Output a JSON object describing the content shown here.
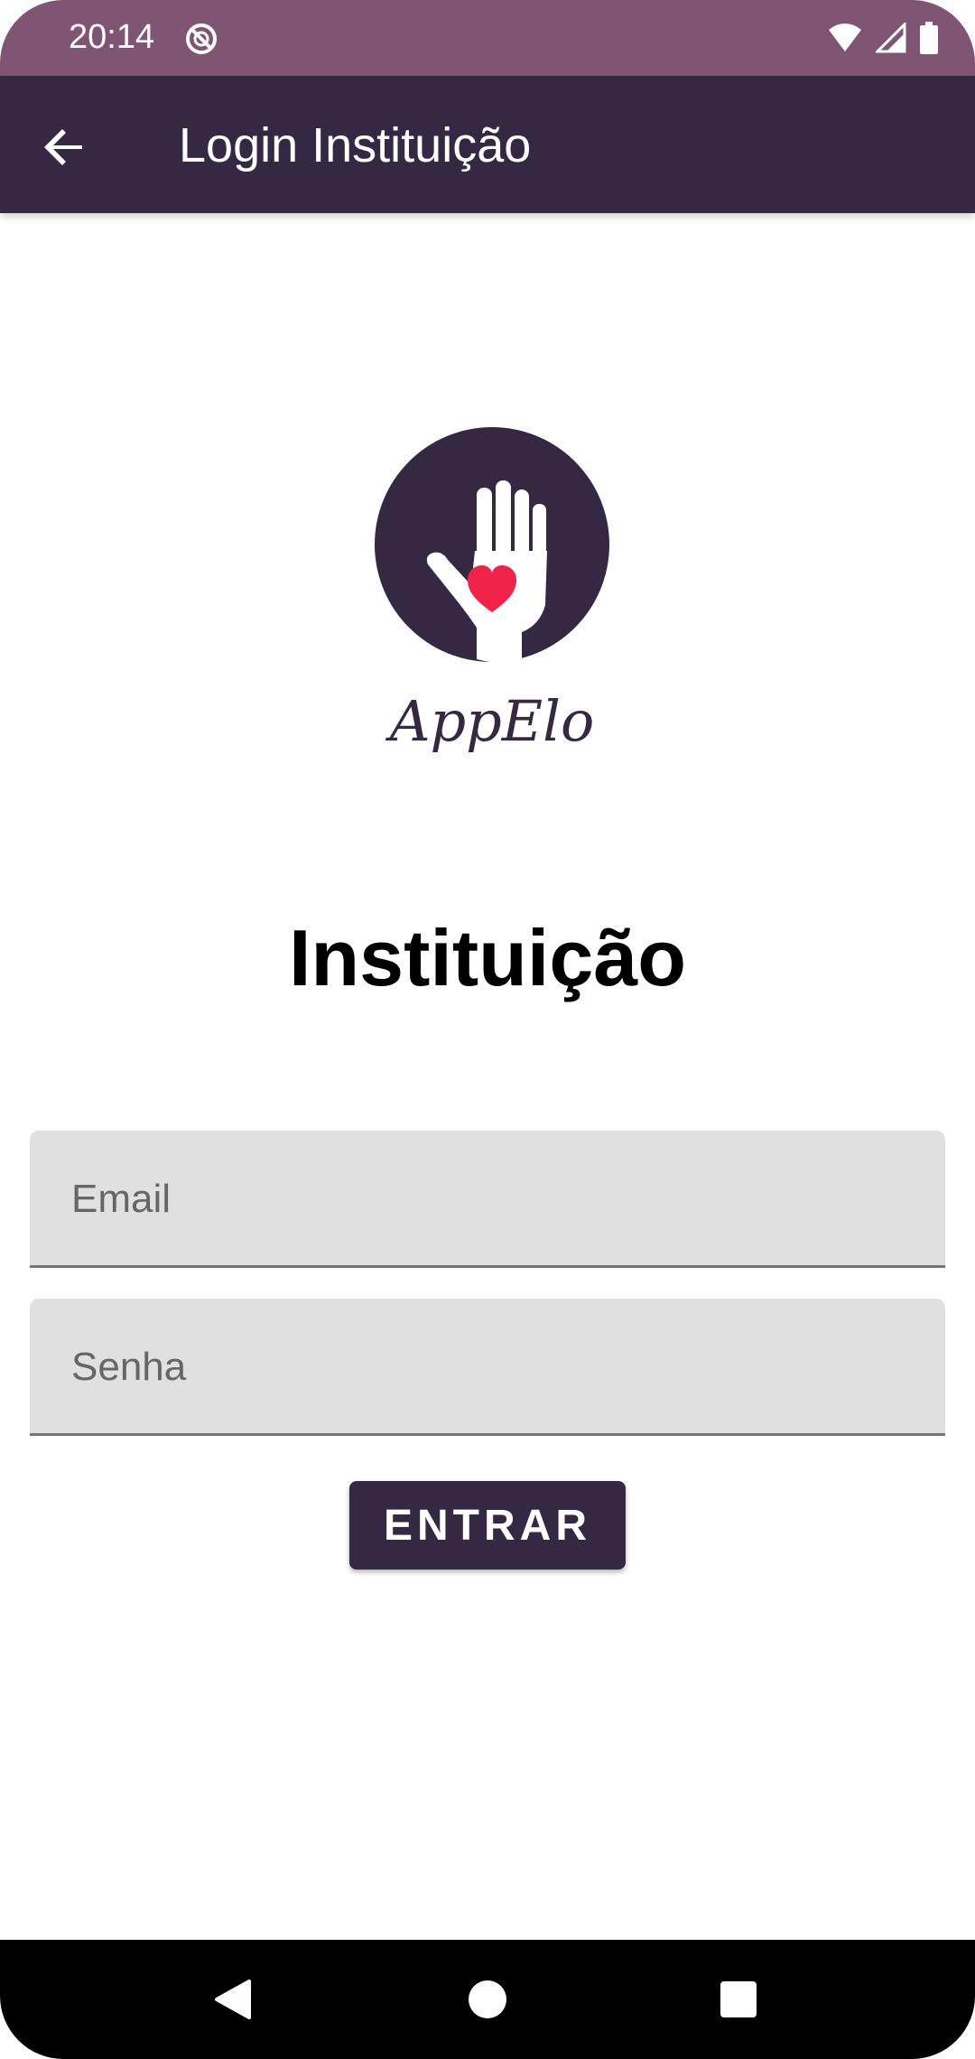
{
  "status_bar": {
    "time": "20:14",
    "icons": [
      "do-not-disturb-icon",
      "wifi-icon",
      "signal-icon",
      "battery-icon"
    ]
  },
  "app_bar": {
    "title": "Login Instituição",
    "back_icon": "arrow-back-icon"
  },
  "logo": {
    "text": "AppElo",
    "icon": "hand-heart-icon"
  },
  "heading": "Instituição",
  "form": {
    "email": {
      "placeholder": "Email",
      "value": ""
    },
    "password": {
      "placeholder": "Senha",
      "value": ""
    },
    "submit_label": "ENTRAR"
  },
  "nav_bar": {
    "items": [
      "back-triangle-icon",
      "home-circle-icon",
      "recents-square-icon"
    ]
  },
  "colors": {
    "status_bar": "#7f5573",
    "primary": "#342842",
    "heart": "#f0244a",
    "field_bg": "#e0e0e0"
  }
}
